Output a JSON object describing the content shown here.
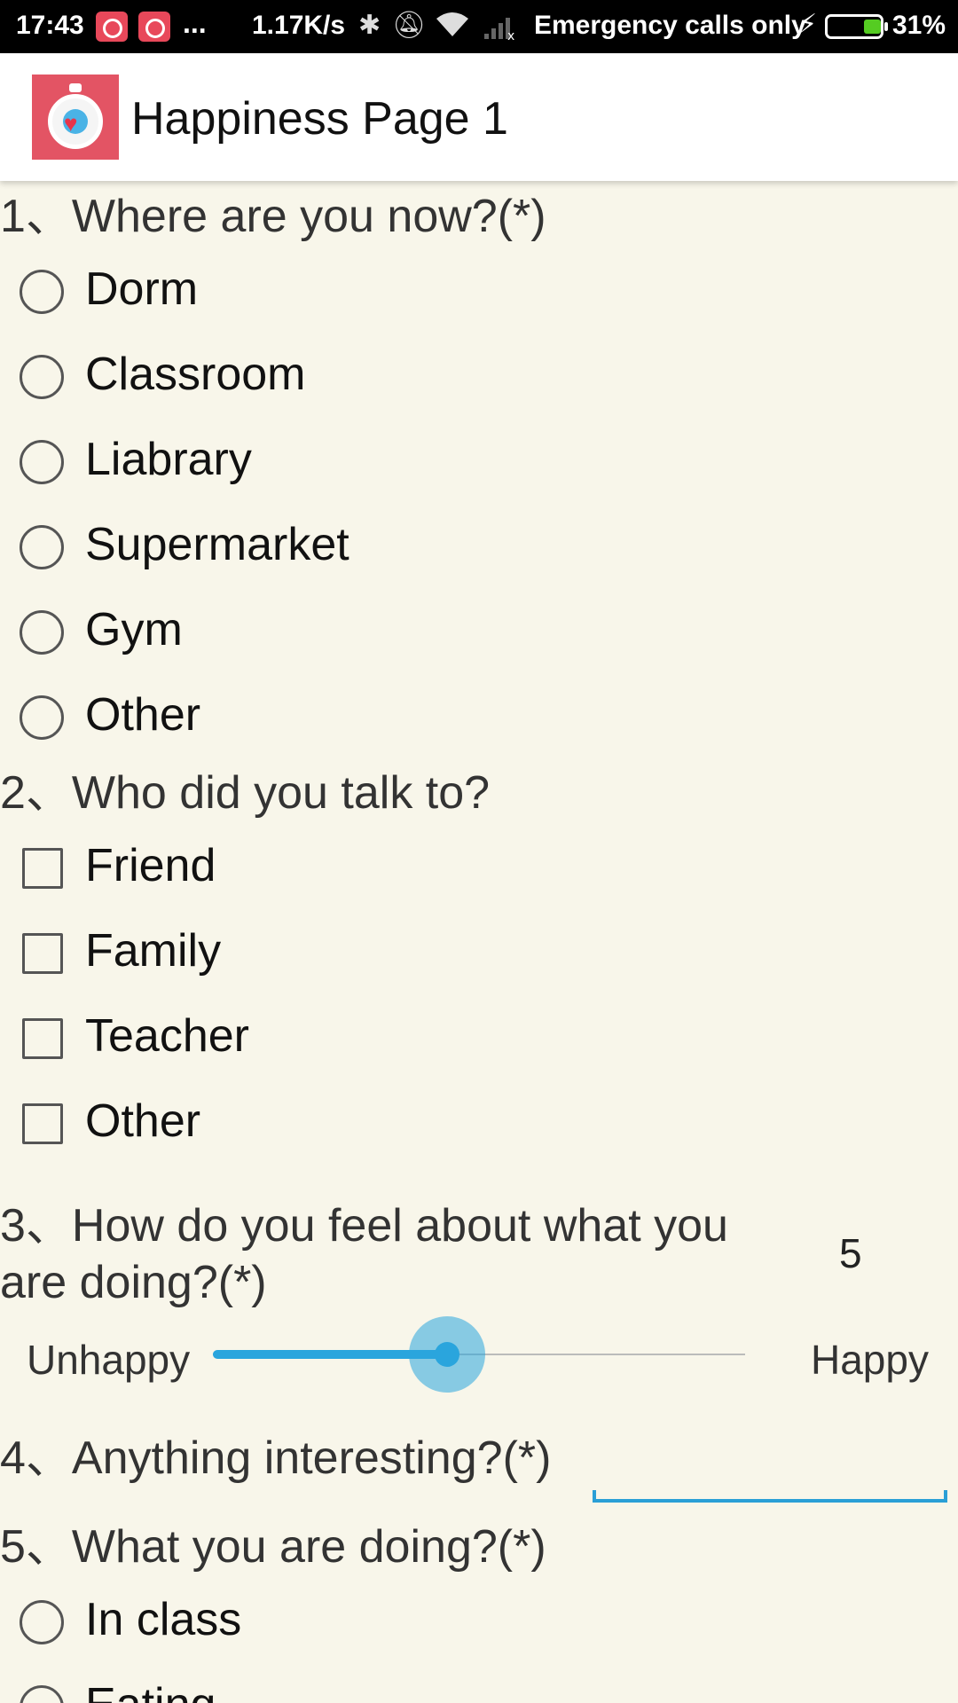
{
  "status_bar": {
    "time": "17:43",
    "dots": "...",
    "speed": "1.17K/s",
    "network": "Emergency calls only",
    "battery": "31%",
    "battery_level": 0.31,
    "icons": [
      "alarm-icon",
      "alarm-icon",
      "bluetooth-icon",
      "bell-off-icon",
      "wifi-icon",
      "no-signal-icon",
      "charging-icon",
      "battery-icon"
    ]
  },
  "app_bar": {
    "title": "Happiness Page 1",
    "logo_icon": "stopwatch-heart-icon"
  },
  "questions": {
    "q1": {
      "title": "1、Where are you now?(*)",
      "options": [
        "Dorm",
        "Classroom",
        "Liabrary",
        "Supermarket",
        "Gym",
        "Other"
      ]
    },
    "q2": {
      "title": "2、Who did you talk to?",
      "options": [
        "Friend",
        "Family",
        "Teacher",
        "Other"
      ]
    },
    "q3": {
      "title_line1": "3、How do you feel about what you",
      "title_line2": "are doing?(*)",
      "value": "5",
      "min_label": "Unhappy",
      "max_label": "Happy",
      "slider_fraction": 0.44
    },
    "q4": {
      "title": "4、Anything interesting?(*)",
      "input_value": ""
    },
    "q5": {
      "title": "5、What you are doing?(*)",
      "options": [
        "In class",
        "Eating"
      ]
    }
  },
  "colors": {
    "background": "#f8f6ea",
    "accent": "#2aa5dd",
    "logo": "#e35464"
  }
}
